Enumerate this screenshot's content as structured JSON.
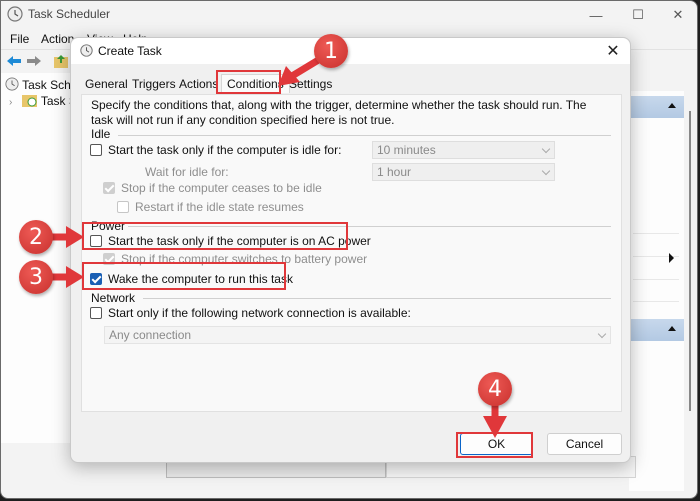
{
  "main_window": {
    "title": "Task Scheduler",
    "controls": {
      "minimize": "—",
      "maximize": "☐",
      "close": "✕"
    },
    "menu": [
      "File",
      "Action",
      "View",
      "Help"
    ],
    "tree": [
      {
        "label": "Task Scheduler (Local)"
      },
      {
        "label": "Task Scheduler Library"
      }
    ]
  },
  "dialog": {
    "title": "Create Task",
    "close": "✕",
    "tabs": [
      {
        "label": "General",
        "active": false
      },
      {
        "label": "Triggers",
        "active": false
      },
      {
        "label": "Actions",
        "active": false
      },
      {
        "label": "Conditions",
        "active": true
      },
      {
        "label": "Settings",
        "active": false
      }
    ],
    "description": "Specify the conditions that, along with the trigger, determine whether the task should run.  The task will not run  if any condition specified here is not true.",
    "idle": {
      "group_label": "Idle",
      "start_if_idle": {
        "label": "Start the task only if the computer is idle for:",
        "checked": false,
        "enabled": true
      },
      "idle_for_value": "10 minutes",
      "wait_label": "Wait for idle for:",
      "wait_value": "1 hour",
      "stop_if_ceases": {
        "label": "Stop if the computer ceases to be idle",
        "checked": true,
        "enabled": false
      },
      "restart_if_resumes": {
        "label": "Restart if the idle state resumes",
        "checked": false,
        "enabled": false
      }
    },
    "power": {
      "group_label": "Power",
      "ac_power": {
        "label": "Start the task only if the computer is on AC power",
        "checked": false,
        "enabled": true
      },
      "battery_stop": {
        "label": "Stop if the computer switches to battery power",
        "checked": true,
        "enabled": false
      },
      "wake": {
        "label": "Wake the computer to run this task",
        "checked": true,
        "enabled": true
      }
    },
    "network": {
      "group_label": "Network",
      "start_if_network": {
        "label": "Start only if the following network connection is available:",
        "checked": false,
        "enabled": true
      },
      "connection_value": "Any connection"
    },
    "buttons": {
      "ok": "OK",
      "cancel": "Cancel"
    }
  },
  "annotations": [
    {
      "number": "1",
      "target": "Conditions tab"
    },
    {
      "number": "2",
      "target": "AC power checkbox"
    },
    {
      "number": "3",
      "target": "Wake computer checkbox"
    },
    {
      "number": "4",
      "target": "OK button"
    }
  ],
  "colors": {
    "annotation": "#e0373a",
    "checkbox_checked": "#1a5fb4",
    "actions_header": "#b3c9e3"
  }
}
